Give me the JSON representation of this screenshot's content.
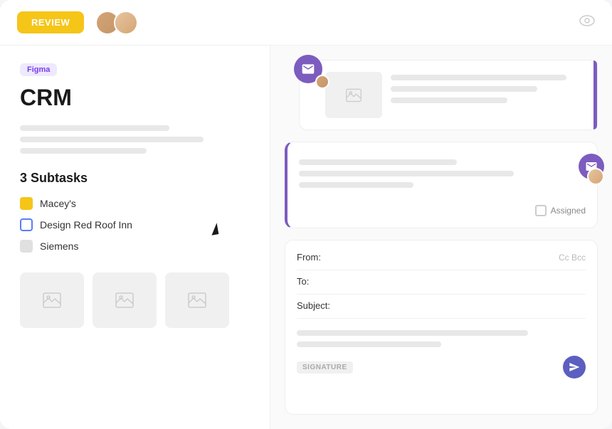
{
  "header": {
    "review_label": "REVIEW",
    "eye_label": "👁"
  },
  "left": {
    "badge": "Figma",
    "title": "CRM",
    "subtasks_title": "3 Subtasks",
    "subtasks": [
      {
        "name": "Macey's",
        "icon": "yellow"
      },
      {
        "name": "Design Red Roof Inn",
        "icon": "blue"
      },
      {
        "name": "Siemens",
        "icon": "grey"
      }
    ]
  },
  "right": {
    "email_card_1": {
      "lines": 3
    },
    "email_card_2": {
      "assigned_label": "Assigned",
      "lines": 3
    },
    "compose": {
      "from_label": "From:",
      "to_label": "To:",
      "subject_label": "Subject:",
      "cc_label": "Cc Bcc",
      "signature_label": "SIGNATURE"
    }
  },
  "colors": {
    "accent": "#7c5cbf",
    "yellow": "#f5c518",
    "blue": "#5b7cfa"
  }
}
